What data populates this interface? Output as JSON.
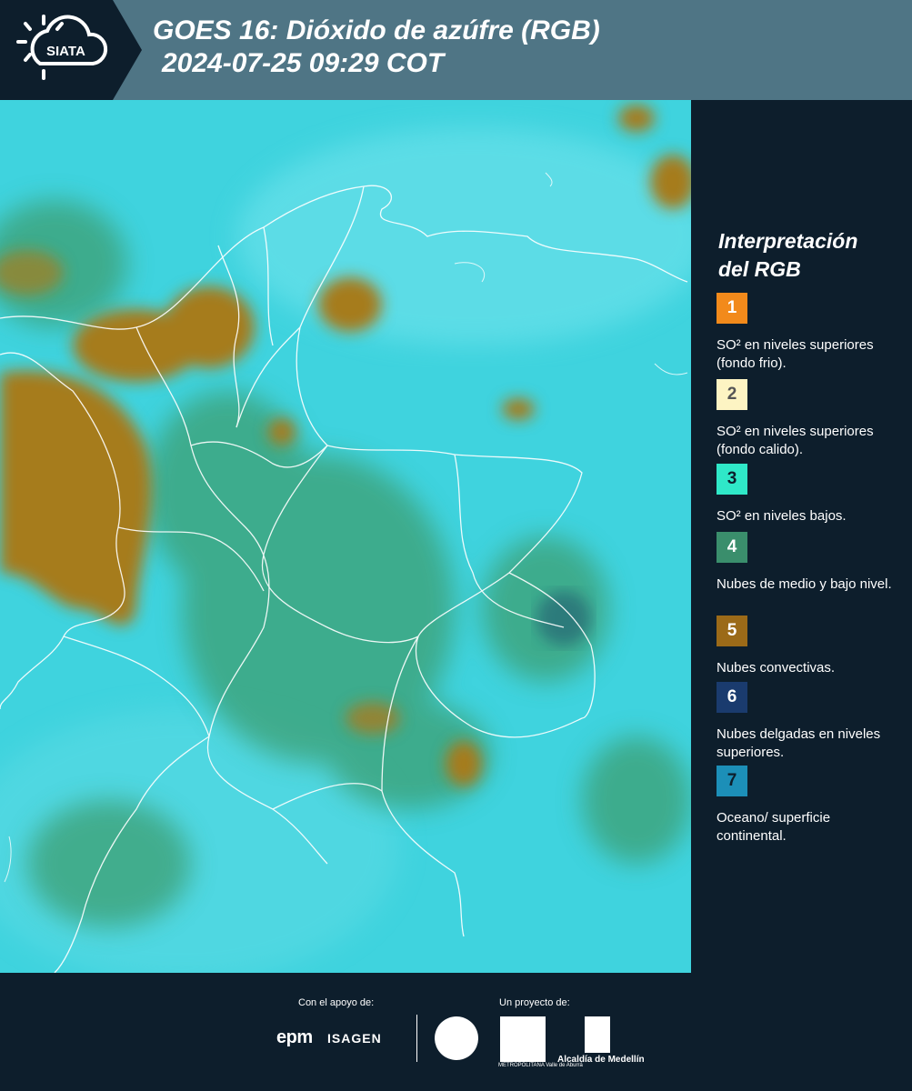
{
  "header": {
    "logo_text": "SIATA",
    "title_line1": "GOES 16: Dióxido de azúfre (RGB)",
    "title_line2": "2024-07-25 09:29 COT"
  },
  "map": {
    "base_color": "#3fd3de",
    "convective_color": "#a67c1e",
    "low_cloud_color": "#3e9f72",
    "border_color": "#ffffff"
  },
  "legend": {
    "title_line1": "Interpretación",
    "title_line2": "del RGB",
    "items": [
      {
        "number": "1",
        "color": "#f28a1b",
        "text_color": "#ffffff",
        "label": "SO² en niveles superiores (fondo frio)."
      },
      {
        "number": "2",
        "color": "#fdf4c3",
        "text_color": "#555555",
        "label": "SO² en niveles superiores (fondo calido)."
      },
      {
        "number": "3",
        "color": "#2fe8c8",
        "text_color": "#0d1e2c",
        "label": "SO² en niveles bajos."
      },
      {
        "number": "4",
        "color": "#3a8e6c",
        "text_color": "#ffffff",
        "label": "Nubes de medio y bajo nivel."
      },
      {
        "number": "5",
        "color": "#9b6a18",
        "text_color": "#ffffff",
        "label": "Nubes convectivas."
      },
      {
        "number": "6",
        "color": "#1a3b6e",
        "text_color": "#ffffff",
        "label": "Nubes delgadas en niveles superiores."
      },
      {
        "number": "7",
        "color": "#1c8fb8",
        "text_color": "#0d1e2c",
        "label": "Oceano/ superficie continental."
      }
    ]
  },
  "footer": {
    "support_label": "Con el apoyo de:",
    "project_label": "Un proyecto de:",
    "epm": "epm",
    "isagen": "ISAGEN",
    "area_caption": "METROPOLITANA Valle de Aburrá",
    "alcaldia": "Alcaldía de Medellín"
  }
}
